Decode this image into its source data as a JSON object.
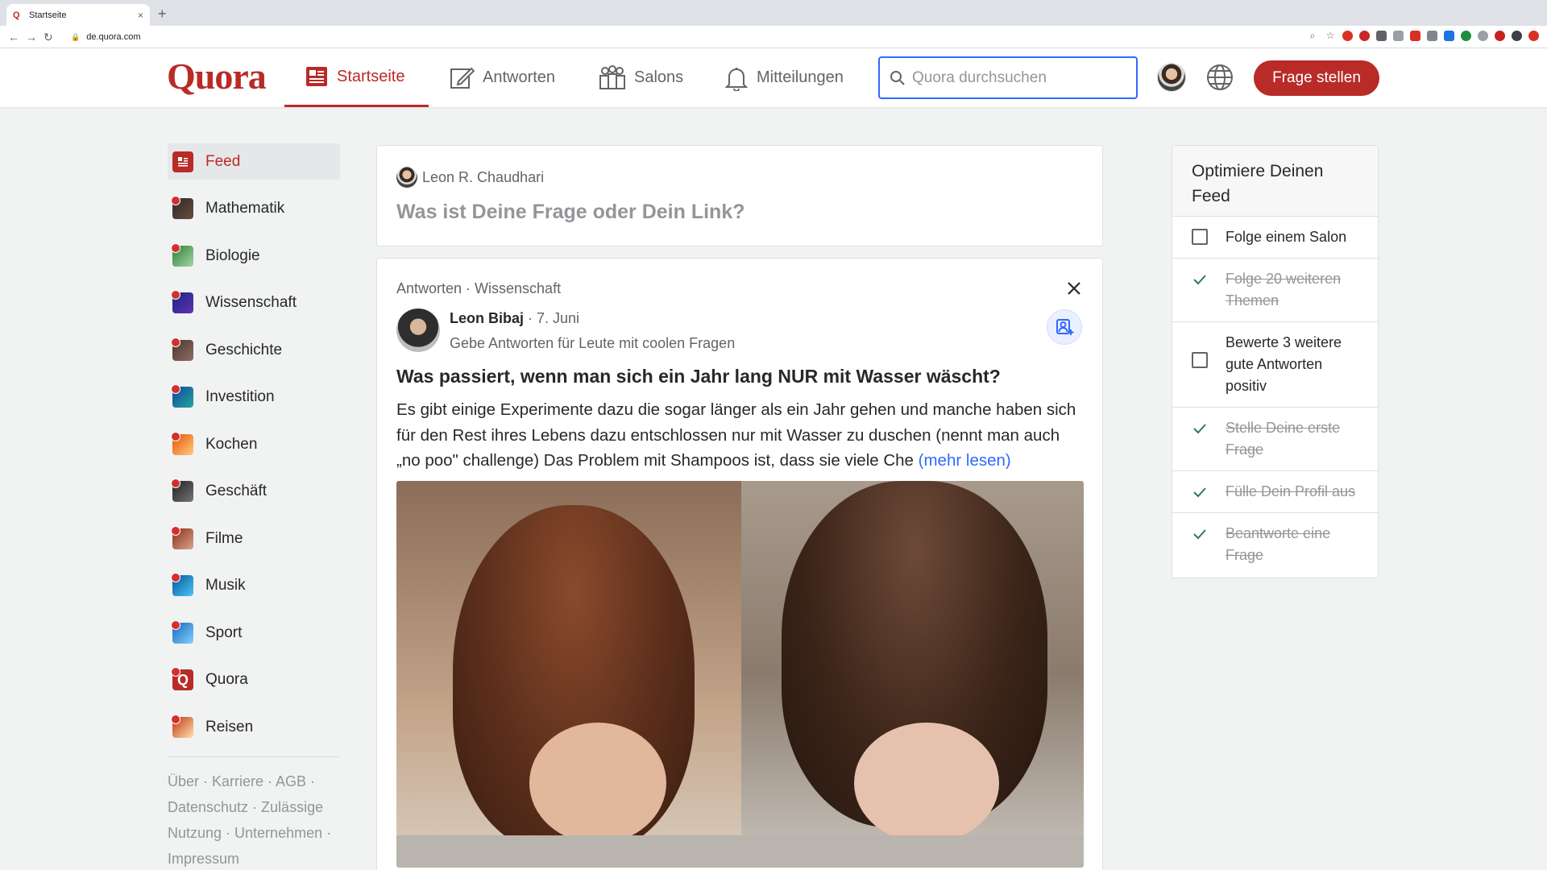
{
  "browser": {
    "tab_title": "Startseite",
    "tab_close": "×",
    "new_tab": "+",
    "url": "de.quora.com"
  },
  "header": {
    "logo": "Quora",
    "nav": [
      {
        "label": "Startseite",
        "icon": "home-icon",
        "active": true
      },
      {
        "label": "Antworten",
        "icon": "edit-icon",
        "active": false
      },
      {
        "label": "Salons",
        "icon": "people-icon",
        "active": false
      },
      {
        "label": "Mitteilungen",
        "icon": "bell-icon",
        "active": false
      }
    ],
    "search_placeholder": "Quora durchsuchen",
    "ask_button": "Frage stellen",
    "accent_color": "#b92b27"
  },
  "sidebar": {
    "items": [
      {
        "label": "Feed",
        "active": true
      },
      {
        "label": "Mathematik"
      },
      {
        "label": "Biologie"
      },
      {
        "label": "Wissenschaft"
      },
      {
        "label": "Geschichte"
      },
      {
        "label": "Investition"
      },
      {
        "label": "Kochen"
      },
      {
        "label": "Geschäft"
      },
      {
        "label": "Filme"
      },
      {
        "label": "Musik"
      },
      {
        "label": "Sport"
      },
      {
        "label": "Quora"
      },
      {
        "label": "Reisen"
      }
    ],
    "footer": "Über · Karriere · AGB · Datenschutz · Zulässige Nutzung · Unternehmen · Impressum"
  },
  "ask_box": {
    "user": "Leon R. Chaudhari",
    "prompt": "Was ist Deine Frage oder Dein Link?"
  },
  "post": {
    "meta": "Antworten · Wissenschaft",
    "author": "Leon Bibaj",
    "date": " · 7. Juni",
    "bio": "Gebe Antworten für Leute mit coolen Fragen",
    "title": "Was passiert, wenn man sich ein Jahr lang NUR mit Wasser wäscht?",
    "body": "Es gibt einige Experimente dazu die sogar länger als ein Jahr gehen und manche haben sich für den Rest ihres Lebens dazu entschlossen nur mit Wasser zu duschen (nennt man auch „no poo\" challenge) Das Problem mit Shampoos ist, dass sie viele Che",
    "more": "(mehr lesen)"
  },
  "optimize": {
    "title": "Optimiere Deinen Feed",
    "items": [
      {
        "label": "Folge einem Salon",
        "done": false
      },
      {
        "label": "Folge 20 weiteren Themen",
        "done": true
      },
      {
        "label": "Bewerte 3 weitere gute Antworten positiv",
        "done": false
      },
      {
        "label": "Stelle Deine erste Frage",
        "done": true
      },
      {
        "label": "Fülle Dein Profil aus",
        "done": true
      },
      {
        "label": "Beantworte eine Frage",
        "done": true
      }
    ]
  }
}
